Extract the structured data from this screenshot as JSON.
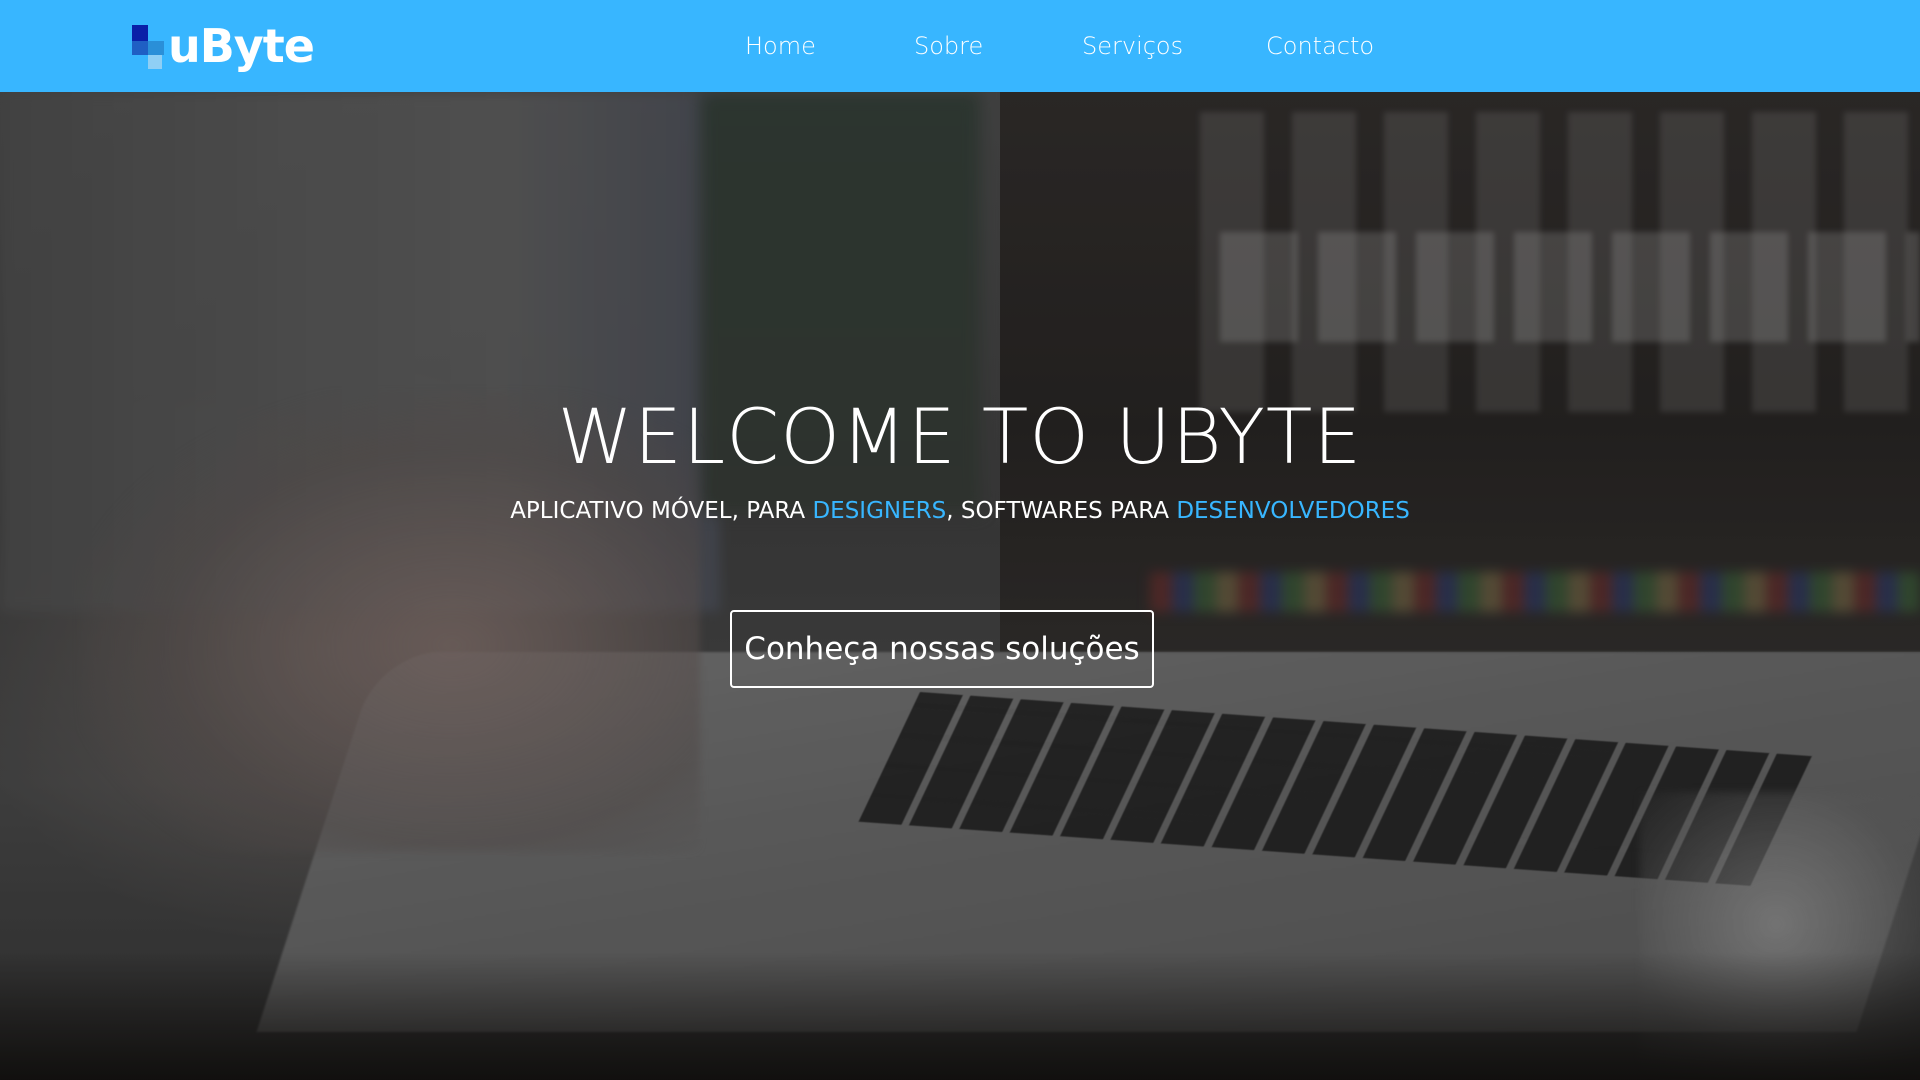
{
  "brand": {
    "name": "uByte",
    "color": "#38b6ff"
  },
  "nav": {
    "items": [
      {
        "label": "Home"
      },
      {
        "label": "Sobre"
      },
      {
        "label": "Serviços"
      },
      {
        "label": "Contacto"
      }
    ]
  },
  "hero": {
    "title": "WELCOME TO UBYTE",
    "subtitle": {
      "part1": "APLICATIVO MÓVEL, PARA ",
      "highlight1": "DESIGNERS",
      "part2": ", SOFTWARES PARA ",
      "highlight2": "DESENVOLVEDORES",
      "highlight_color": "#38b6ff"
    },
    "cta_label": "Conheça nossas soluções",
    "background_image": "blurred photo of a hand on a laptop keyboard"
  }
}
